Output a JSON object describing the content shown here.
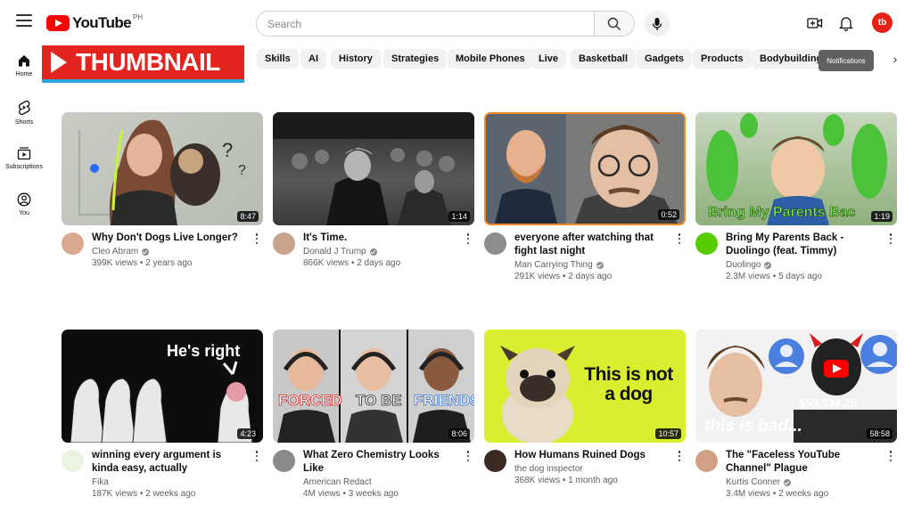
{
  "header": {
    "logo_text": "YouTube",
    "region": "PH",
    "search_placeholder": "Search",
    "avatar_text": "tb"
  },
  "banner": {
    "text": "THUMBNAIL"
  },
  "sidebar": {
    "items": [
      {
        "label": "Home",
        "icon": "home-icon"
      },
      {
        "label": "Shorts",
        "icon": "shorts-icon"
      },
      {
        "label": "Subscriptions",
        "icon": "subscriptions-icon"
      },
      {
        "label": "You",
        "icon": "you-icon"
      }
    ]
  },
  "chips": [
    "Skills",
    "AI",
    "History",
    "Strategies",
    "Mobile Phones",
    "Live",
    "Basketball",
    "Gadgets",
    "Products",
    "Bodybuilding"
  ],
  "tooltip": "Notifications",
  "colors": {
    "brand_red": "#ff0000",
    "banner_red": "#e3231d",
    "banner_underline": "#2aa7d6"
  },
  "videos": [
    {
      "title": "Why Don't Dogs Live Longer?",
      "channel": "Cleo Abram",
      "verified": true,
      "views": "399K views",
      "age": "2 years ago",
      "duration": "8:47"
    },
    {
      "title": "It's Time.",
      "channel": "Donald J Trump",
      "verified": true,
      "views": "866K views",
      "age": "2 days ago",
      "duration": "1:14"
    },
    {
      "title": "everyone after watching that fight last night",
      "channel": "Man Carrying Thing",
      "verified": true,
      "views": "291K views",
      "age": "2 days ago",
      "duration": "0:52"
    },
    {
      "title": "Bring My Parents Back - Duolingo (feat. Timmy)",
      "channel": "Duolingo",
      "verified": true,
      "views": "2.3M views",
      "age": "5 days ago",
      "duration": "1:19",
      "thumb_text": "Bring My Parents Bac"
    },
    {
      "title": "winning every argument is kinda easy, actually",
      "channel": "Fika",
      "verified": false,
      "views": "187K views",
      "age": "2 weeks ago",
      "duration": "4:23",
      "thumb_text": "He's right"
    },
    {
      "title": "What Zero Chemistry Looks Like",
      "channel": "American Redact",
      "verified": false,
      "views": "4M views",
      "age": "3 weeks ago",
      "duration": "8:06",
      "thumb_words": [
        "FORCED",
        "TO BE",
        "FRIENDS"
      ]
    },
    {
      "title": "How Humans Ruined Dogs",
      "channel": "the dog inspector",
      "verified": false,
      "views": "368K views",
      "age": "1 month ago",
      "duration": "10:57",
      "thumb_text": "This is not a dog"
    },
    {
      "title": "The \"Faceless YouTube Channel\" Plague",
      "channel": "Kurtis Conner",
      "verified": true,
      "views": "3.4M views",
      "age": "2 weeks ago",
      "duration": "58:58",
      "thumb_amount": "$59,334.25",
      "thumb_text": "this is bad..."
    }
  ]
}
